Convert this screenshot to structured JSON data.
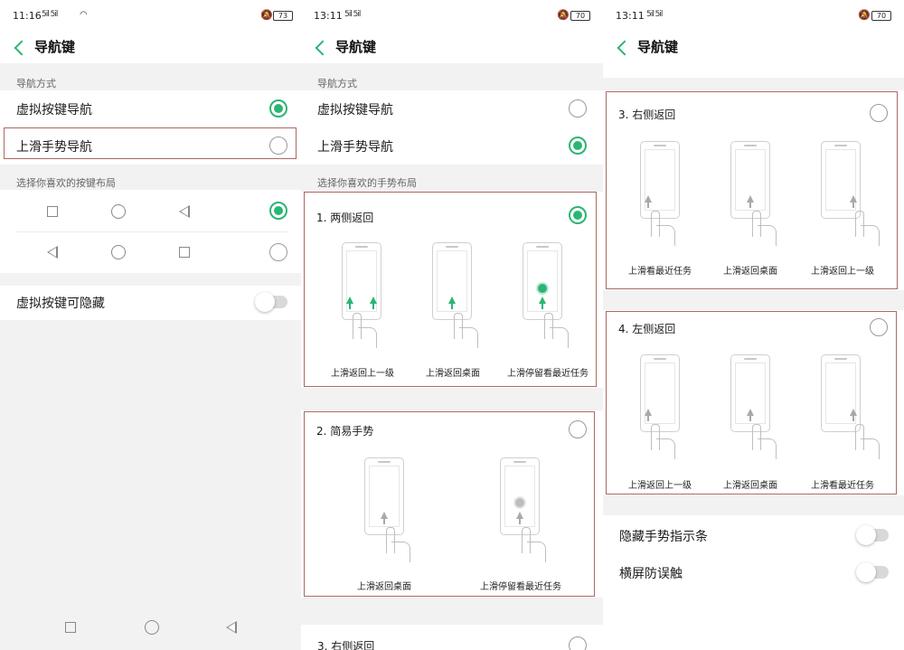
{
  "panel1": {
    "status": {
      "time": "11:16",
      "signal": "5il 5il",
      "battery": "73"
    },
    "title": "导航键",
    "section1": "导航方式",
    "opt1": "虚拟按键导航",
    "opt2": "上滑手势导航",
    "section2": "选择你喜欢的按键布局",
    "hide_label": "虚拟按键可隐藏"
  },
  "panel2": {
    "status": {
      "time": "13:11",
      "signal": "5il 5il",
      "battery": "70"
    },
    "title": "导航键",
    "section1": "导航方式",
    "opt1": "虚拟按键导航",
    "opt2": "上滑手势导航",
    "section2": "选择你喜欢的手势布局",
    "card1": {
      "title": "1. 两侧返回",
      "caps": [
        "上滑返回上一级",
        "上滑返回桌面",
        "上滑停留看最近任务"
      ]
    },
    "card2": {
      "title": "2. 简易手势",
      "caps": [
        "上滑返回桌面",
        "上滑停留看最近任务"
      ]
    },
    "card3_title": "3. 右侧返回"
  },
  "panel3": {
    "status": {
      "time": "13:11",
      "signal": "5il 5il",
      "battery": "70"
    },
    "title": "导航键",
    "card3": {
      "title": "3. 右侧返回",
      "caps": [
        "上滑看最近任务",
        "上滑返回桌面",
        "上滑返回上一级"
      ]
    },
    "card4": {
      "title": "4. 左侧返回",
      "caps": [
        "上滑返回上一级",
        "上滑返回桌面",
        "上滑看最近任务"
      ]
    },
    "hide_bar": "隐藏手势指示条",
    "landscape": "横屏防误触"
  },
  "colors": {
    "accent": "#2bb574",
    "highlight": "#a86a5f",
    "bg_gray": "#f2f2f2"
  }
}
